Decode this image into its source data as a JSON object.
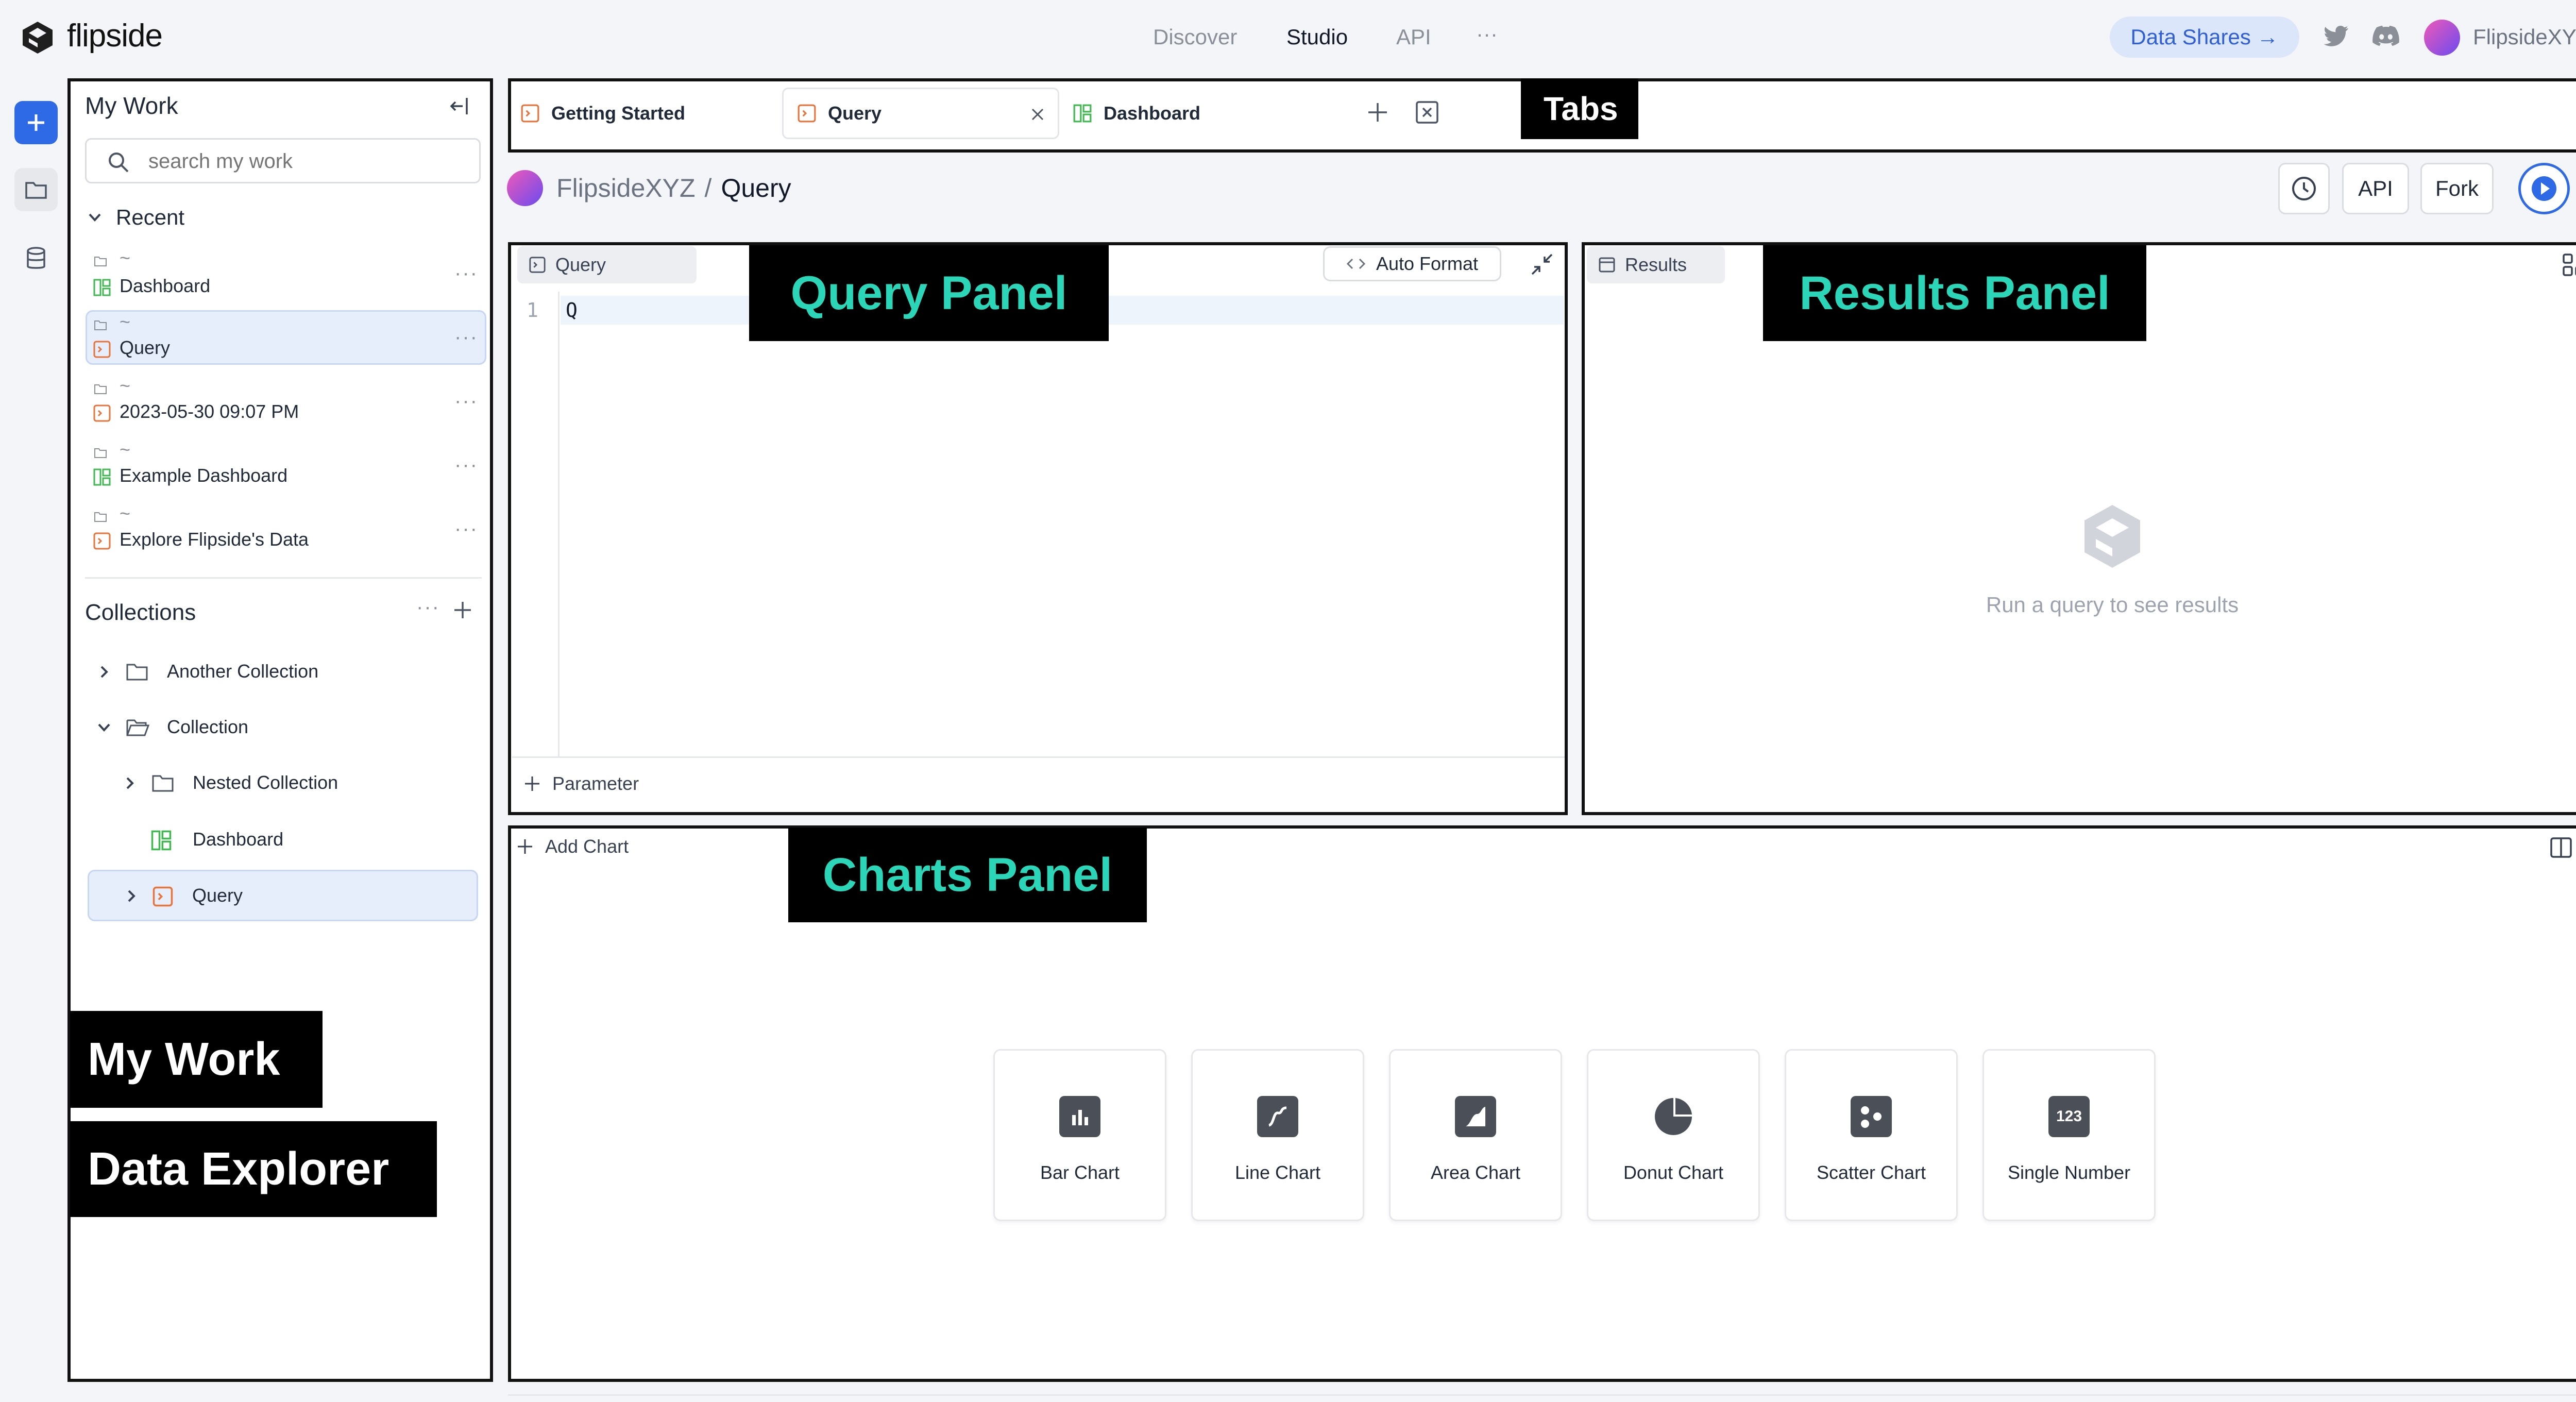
{
  "topnav": {
    "logo": "flipside",
    "links": [
      "Discover",
      "Studio",
      "API"
    ],
    "more": "···",
    "data_shares": "Data Shares →",
    "user": "FlipsideXYZ"
  },
  "annotations": {
    "tabs": "Tabs",
    "query_panel": "Query Panel",
    "results_panel": "Results Panel",
    "charts_panel": "Charts Panel",
    "my_work": "My Work",
    "data_explorer": "Data Explorer"
  },
  "my_work": {
    "title": "My Work",
    "search_placeholder": "search my work",
    "recent_label": "Recent",
    "recent": [
      {
        "path": "~",
        "name": "Dashboard",
        "type": "dashboard"
      },
      {
        "path": "~",
        "name": "Query",
        "type": "query"
      },
      {
        "path": "~",
        "name": "2023-05-30 09:07 PM",
        "type": "query"
      },
      {
        "path": "~",
        "name": "Example Dashboard",
        "type": "dashboard"
      },
      {
        "path": "~",
        "name": "Explore Flipside's Data",
        "type": "query"
      }
    ],
    "more": "···",
    "collections_label": "Collections",
    "collections": [
      {
        "name": "Another Collection"
      },
      {
        "name": "Collection"
      },
      {
        "name": "Nested Collection"
      },
      {
        "name": "Dashboard"
      },
      {
        "name": "Query"
      }
    ]
  },
  "tabs": [
    {
      "label": "Getting Started",
      "type": "query"
    },
    {
      "label": "Query",
      "type": "query"
    },
    {
      "label": "Dashboard",
      "type": "dashboard"
    }
  ],
  "toolbar": {
    "owner": "FlipsideXYZ",
    "separator": "/",
    "name": "Query",
    "api": "API",
    "fork": "Fork"
  },
  "query_panel": {
    "tab_label": "Query",
    "auto_format": "Auto Format",
    "line_number": "1",
    "code": "Q",
    "parameter": "Parameter"
  },
  "results_panel": {
    "tab_label": "Results",
    "empty_text": "Run a query to see results"
  },
  "charts_panel": {
    "add_chart": "Add Chart",
    "types": [
      {
        "label": "Bar Chart",
        "icon": "bar-chart-icon"
      },
      {
        "label": "Line Chart",
        "icon": "line-chart-icon"
      },
      {
        "label": "Area Chart",
        "icon": "area-chart-icon"
      },
      {
        "label": "Donut Chart",
        "icon": "donut-chart-icon"
      },
      {
        "label": "Scatter Chart",
        "icon": "scatter-chart-icon"
      },
      {
        "label": "Single Number",
        "icon": "single-number-icon",
        "glyph": "123"
      }
    ]
  },
  "colors": {
    "accent": "#2f5fd7",
    "teal": "#2ad5b8",
    "query_orange": "#e8743b",
    "dashboard_green": "#3fb950"
  }
}
